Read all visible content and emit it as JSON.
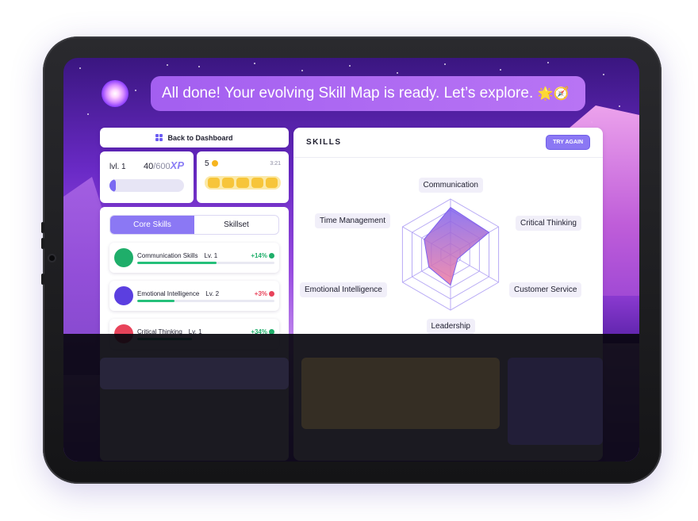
{
  "assistant": {
    "message": "All done! Your evolving Skill Map is ready. Let’s explore.",
    "emojis": "🌟🧭"
  },
  "nav": {
    "back_label": "Back to Dashboard"
  },
  "level": {
    "label": "lvl. 1",
    "xp_current": "40",
    "xp_max": "/600",
    "xp_unit": "XP",
    "xp_progress": 0.067
  },
  "streak": {
    "count": "5",
    "time": "3:21",
    "days_filled": 5
  },
  "tabs": {
    "core": "Core Skills",
    "skillset": "Skillset"
  },
  "skills": [
    {
      "name": "Communication Skills",
      "level": "Lv. 1",
      "delta": "+14%",
      "trend": "up",
      "progress": 0.58,
      "icon": "communication-icon",
      "color": "#1fae6a"
    },
    {
      "name": "Emotional Intelligence",
      "level": "Lv. 2",
      "delta": "+3%",
      "trend": "down",
      "progress": 0.27,
      "icon": "emotional-intelligence-icon",
      "color": "#5b3fe0"
    },
    {
      "name": "Critical Thinking",
      "level": "Lv. 1",
      "delta": "+34%",
      "trend": "up",
      "progress": 0.4,
      "icon": "critical-thinking-icon",
      "color": "#e8435a"
    }
  ],
  "chart_header": {
    "title": "SKILLS",
    "try_again": "TRY AGAIN"
  },
  "chart_data": {
    "type": "radar",
    "axes": [
      "Communication",
      "Critical Thinking",
      "Customer Service",
      "Leadership",
      "Emotional Intelligence",
      "Time Management"
    ],
    "values": [
      0.85,
      0.8,
      0.15,
      0.55,
      0.45,
      0.55
    ],
    "rmax": 1,
    "rings": 5
  },
  "colors": {
    "accent": "#8b78f4",
    "positive": "#1fae6a",
    "negative": "#e8435a"
  }
}
